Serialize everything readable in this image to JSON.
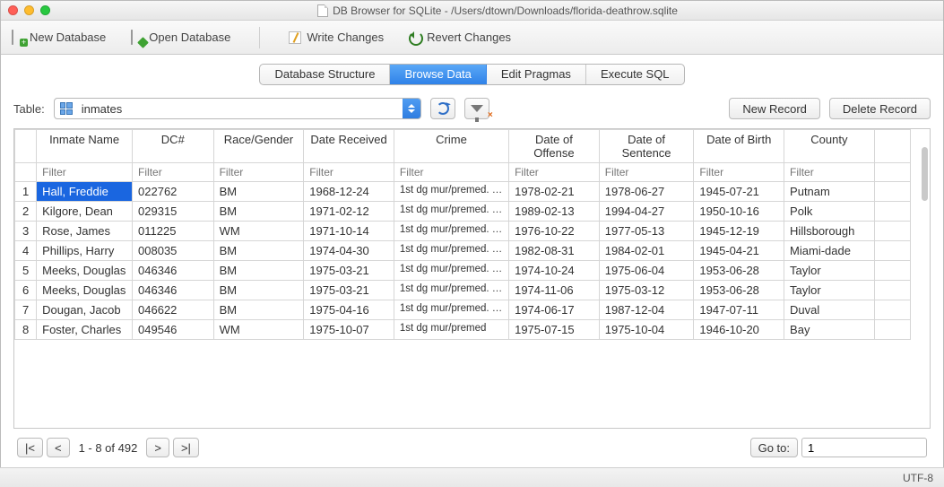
{
  "window": {
    "title": "DB Browser for SQLite - /Users/dtown/Downloads/florida-deathrow.sqlite"
  },
  "toolbar": {
    "new_db": "New Database",
    "open_db": "Open Database",
    "write_changes": "Write Changes",
    "revert_changes": "Revert Changes"
  },
  "tabs": {
    "structure": "Database Structure",
    "browse": "Browse Data",
    "pragmas": "Edit Pragmas",
    "sql": "Execute SQL"
  },
  "browse": {
    "table_label": "Table:",
    "table_name": "inmates",
    "new_record": "New Record",
    "delete_record": "Delete Record"
  },
  "columns": [
    "Inmate Name",
    "DC#",
    "Race/Gender",
    "Date Received",
    "Crime",
    "Date of Offense",
    "Date of Sentence",
    "Date of Birth",
    "County"
  ],
  "filter_placeholder": "Filter",
  "rows": [
    {
      "n": "1",
      "name": "Hall, Freddie",
      "dc": "022762",
      "rg": "BM",
      "recv": "1968-12-24",
      "crime": "1st dg mur/premed. …",
      "off": "1978-02-21",
      "sent": "1978-06-27",
      "dob": "1945-07-21",
      "county": "Putnam"
    },
    {
      "n": "2",
      "name": "Kilgore, Dean",
      "dc": "029315",
      "rg": "BM",
      "recv": "1971-02-12",
      "crime": "1st dg mur/premed. …",
      "off": "1989-02-13",
      "sent": "1994-04-27",
      "dob": "1950-10-16",
      "county": "Polk"
    },
    {
      "n": "3",
      "name": "Rose, James",
      "dc": "011225",
      "rg": "WM",
      "recv": "1971-10-14",
      "crime": "1st dg mur/premed. …",
      "off": "1976-10-22",
      "sent": "1977-05-13",
      "dob": "1945-12-19",
      "county": "Hillsborough"
    },
    {
      "n": "4",
      "name": "Phillips, Harry",
      "dc": "008035",
      "rg": "BM",
      "recv": "1974-04-30",
      "crime": "1st dg mur/premed. …",
      "off": "1982-08-31",
      "sent": "1984-02-01",
      "dob": "1945-04-21",
      "county": "Miami-dade"
    },
    {
      "n": "5",
      "name": "Meeks, Douglas",
      "dc": "046346",
      "rg": "BM",
      "recv": "1975-03-21",
      "crime": "1st dg mur/premed. …",
      "off": "1974-10-24",
      "sent": "1975-06-04",
      "dob": "1953-06-28",
      "county": "Taylor"
    },
    {
      "n": "6",
      "name": "Meeks, Douglas",
      "dc": "046346",
      "rg": "BM",
      "recv": "1975-03-21",
      "crime": "1st dg mur/premed. …",
      "off": "1974-11-06",
      "sent": "1975-03-12",
      "dob": "1953-06-28",
      "county": "Taylor"
    },
    {
      "n": "7",
      "name": "Dougan, Jacob",
      "dc": "046622",
      "rg": "BM",
      "recv": "1975-04-16",
      "crime": "1st dg mur/premed. …",
      "off": "1974-06-17",
      "sent": "1987-12-04",
      "dob": "1947-07-11",
      "county": "Duval"
    },
    {
      "n": "8",
      "name": "Foster, Charles",
      "dc": "049546",
      "rg": "WM",
      "recv": "1975-10-07",
      "crime": "1st dg mur/premed",
      "off": "1975-07-15",
      "sent": "1975-10-04",
      "dob": "1946-10-20",
      "county": "Bay"
    }
  ],
  "pager": {
    "first": "|<",
    "prev": "<",
    "next": ">",
    "last": ">|",
    "range": "1 - 8 of 492",
    "goto_label": "Go to:",
    "goto_value": "1"
  },
  "status": {
    "encoding": "UTF-8"
  }
}
